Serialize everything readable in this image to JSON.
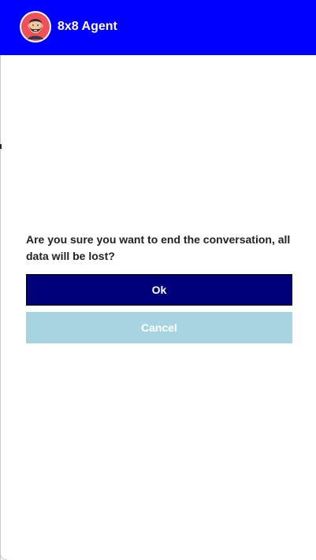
{
  "header": {
    "agent_name": "8x8 Agent",
    "avatar_icon": "bearded-agent-avatar-icon",
    "background_color": "#0000ff"
  },
  "dialog": {
    "message": "Are you sure you want to end the conversation, all data will be lost?",
    "ok_label": "Ok",
    "cancel_label": "Cancel",
    "ok_color": "#00007a",
    "cancel_color": "#a8d4e2"
  }
}
